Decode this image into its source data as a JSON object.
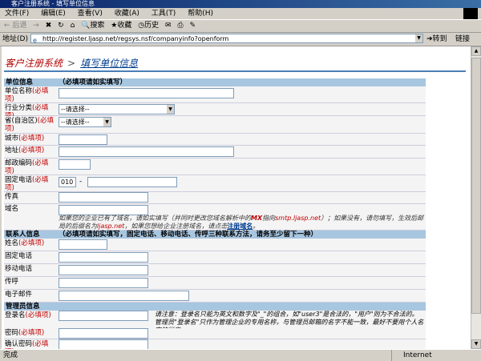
{
  "window": {
    "title": "客户注册系统 - 填写单位信息"
  },
  "menu": [
    "文件(F)",
    "编辑(E)",
    "查看(V)",
    "收藏(A)",
    "工具(T)",
    "帮助(H)"
  ],
  "toolbar": {
    "back": "后退",
    "search": "搜索",
    "favorites": "收藏",
    "history": "历史"
  },
  "address": {
    "label": "地址(D)",
    "url": "http://register.ljasp.net/regsys.nsf/companyinfo?openform",
    "go": "转到",
    "links": "链接"
  },
  "breadcrumb": {
    "root": "客户注册系统",
    "sep": ">",
    "current": "填写单位信息"
  },
  "sections": {
    "company": {
      "title": "单位信息",
      "hint": "（必填项请如实填写）"
    },
    "contact": {
      "title": "联系人信息",
      "hint": "（必填项请如实填写，固定电话、移动电话、传呼三种联系方法，请务至少留下一种）"
    },
    "admin": {
      "title": "管理员信息"
    }
  },
  "required": "(必填项)",
  "fields": {
    "company_name": "单位名称",
    "industry": "行业分类",
    "industry_value": "--请选择--",
    "province": "省(自治区)",
    "province_value": "--请选择--",
    "city": "城市",
    "address": "地址",
    "postcode": "邮政编码",
    "phone": "固定电话",
    "phone_area": "010",
    "phone_dash": "-",
    "fax": "传真",
    "domain": "域名",
    "contact_name": "姓名",
    "contact_phone": "固定电话",
    "mobile": "移动电话",
    "pager": "传呼",
    "email": "电子邮件",
    "login": "登录名",
    "password": "密码",
    "confirm": "确认密码"
  },
  "domain_note": {
    "p1": "如果您的企业已有了域名，请如实填写（并同时更改您域名解析中的",
    "mx": "MX",
    "p2": "指向",
    "smtp": "smtp.ljasp.net",
    "p3": "）；如果没有，请勿填写，生效后邮局的后缀名为",
    "suffix": "ljasp.net",
    "p4": "，如果您想给企业注册域名，请点击",
    "link": "注册域名",
    "p5": "。"
  },
  "login_note": "请注意：登录名只能为英文和数字及\"_\"的组合，如\"user3\"是合法的，\"用户\"则为不合法的。管理员\"登录名\"只作为管理企业的专用名称，与管理员邮箱的名字不能一致，最好不要用个人名字的拼音。",
  "status": {
    "left": "完成",
    "zone": "Internet"
  }
}
